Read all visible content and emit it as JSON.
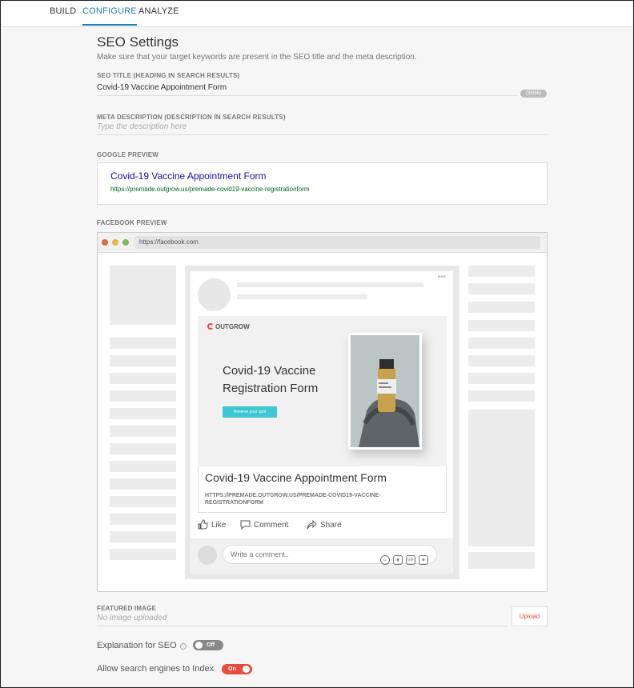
{
  "tabs": [
    {
      "label": "BUILD",
      "active": false
    },
    {
      "label": "CONFIGURE",
      "active": true
    },
    {
      "label": "ANALYZE",
      "active": false
    }
  ],
  "seo": {
    "title": "SEO Settings",
    "subtitle": "Make sure that your target keywords are present in the SEO title and the meta description.",
    "seo_title_label": "SEO TITLE (HEADING IN SEARCH RESULTS)",
    "seo_title_value": "Covid-19 Vaccine Appointment Form",
    "char_count": "(33/55)",
    "meta_label": "META DESCRIPTION (DESCRIPTION IN SEARCH RESULTS)",
    "meta_placeholder": "Type the description here"
  },
  "google_preview": {
    "label": "GOOGLE PREVIEW",
    "title": "Covid-19 Vaccine Appointment Form",
    "url": "https://premade.outgrow.us/premade-covid19-vaccine-registrationform"
  },
  "facebook_preview": {
    "label": "FACEBOOK PREVIEW",
    "browser_url": "https://facebook.com",
    "logo_text": "OUTGROW",
    "image_title": "Covid-19 Vaccine Registration Form",
    "image_button": "Reserve your spot",
    "card_title": "Covid-19 Vaccine Appointment Form",
    "card_url": "HTTPS://PREMADE.OUTGROW.US/PREMADE-COVID19-VACCINE-REGISTRATIONFORM",
    "actions": {
      "like": "Like",
      "comment": "Comment",
      "share": "Share"
    },
    "comment_placeholder": "Write a comment..",
    "comment_icons": [
      "emoji-icon",
      "camera-icon",
      "gif-icon",
      "sticker-icon"
    ]
  },
  "featured_image": {
    "label": "FEATURED IMAGE",
    "placeholder": "No Image uploaded",
    "upload_label": "Upload"
  },
  "toggles": {
    "explanation_label": "Explanation for SEO",
    "explanation_state": "Off",
    "index_label": "Allow search engines to Index",
    "index_state": "On"
  },
  "colors": {
    "accent": "#1f7fb6",
    "toggle_on": "#e84c3d",
    "toggle_off": "#888888",
    "google_link": "#1a0dab",
    "google_url": "#006621"
  }
}
